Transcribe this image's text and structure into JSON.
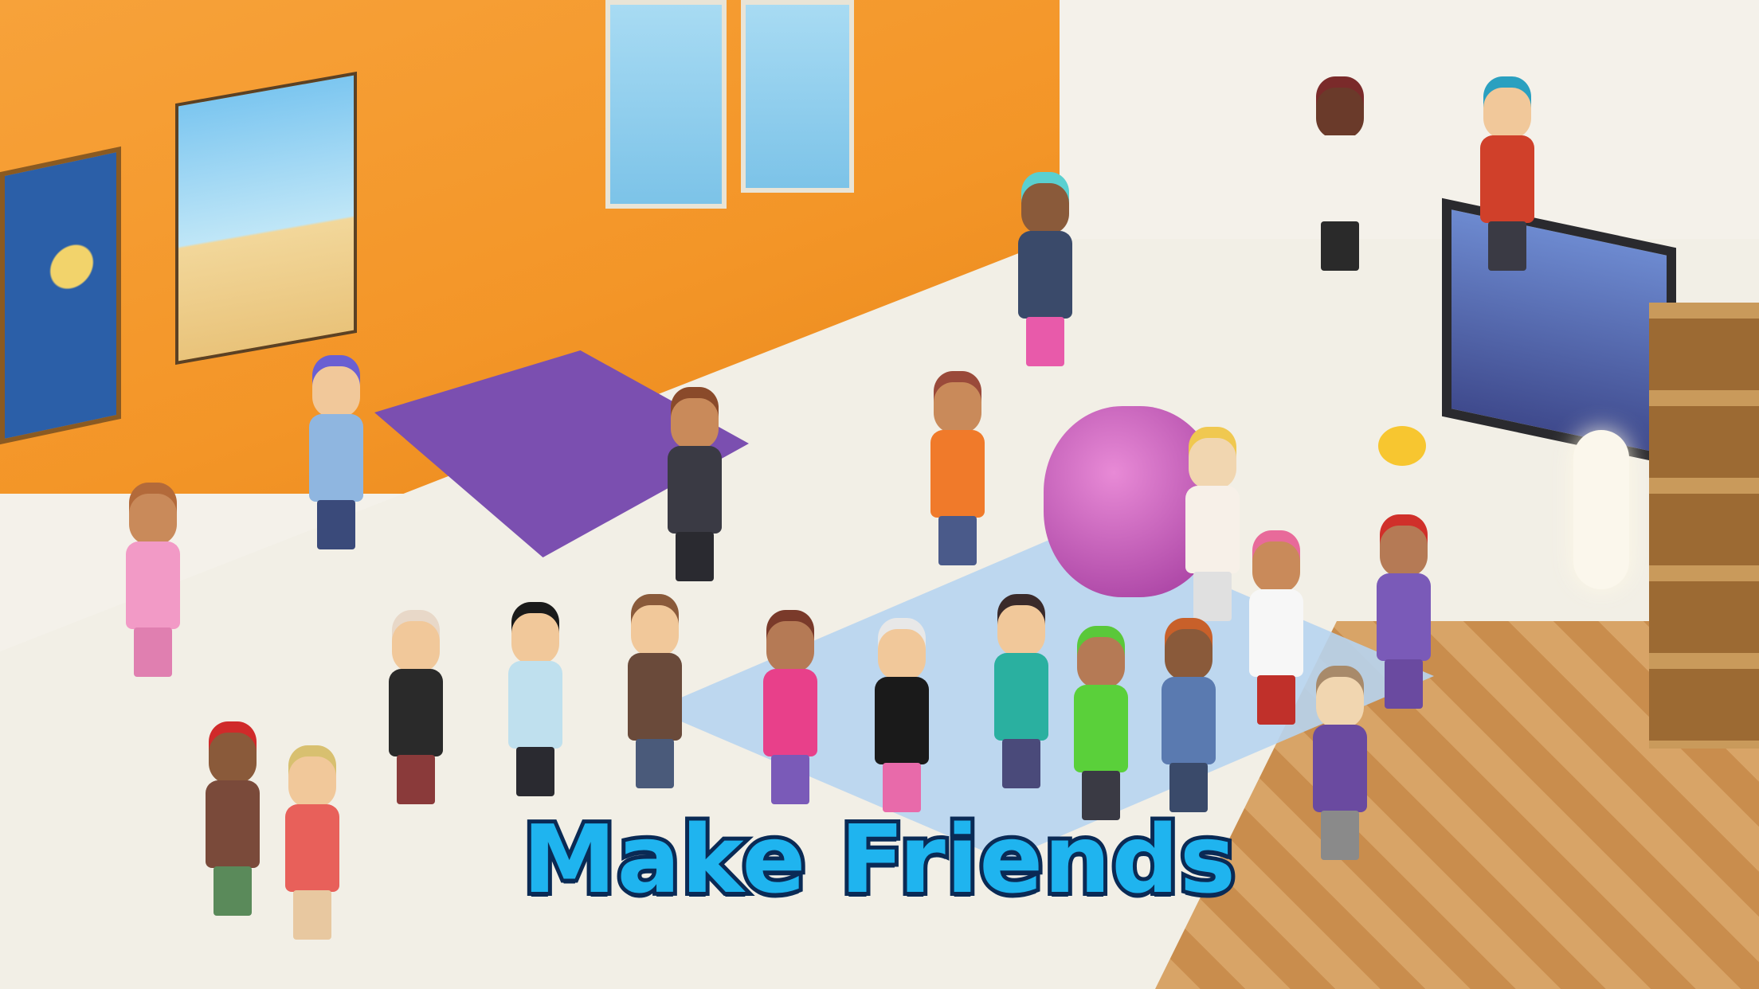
{
  "banner": {
    "title": "Make Friends"
  },
  "colors": {
    "title_fill": "#1fb4ef",
    "title_outline": "#0a2a55",
    "wall": "#f39527",
    "floor": "#f2efe6",
    "rug": "#b7d4ef"
  },
  "scene": {
    "items": [
      "painting-icon",
      "poster-icon",
      "bed-icon",
      "tv-icon",
      "bookshelf-icon",
      "lamp-icon",
      "rubber-duck-icon",
      "beanbag-icon"
    ]
  }
}
